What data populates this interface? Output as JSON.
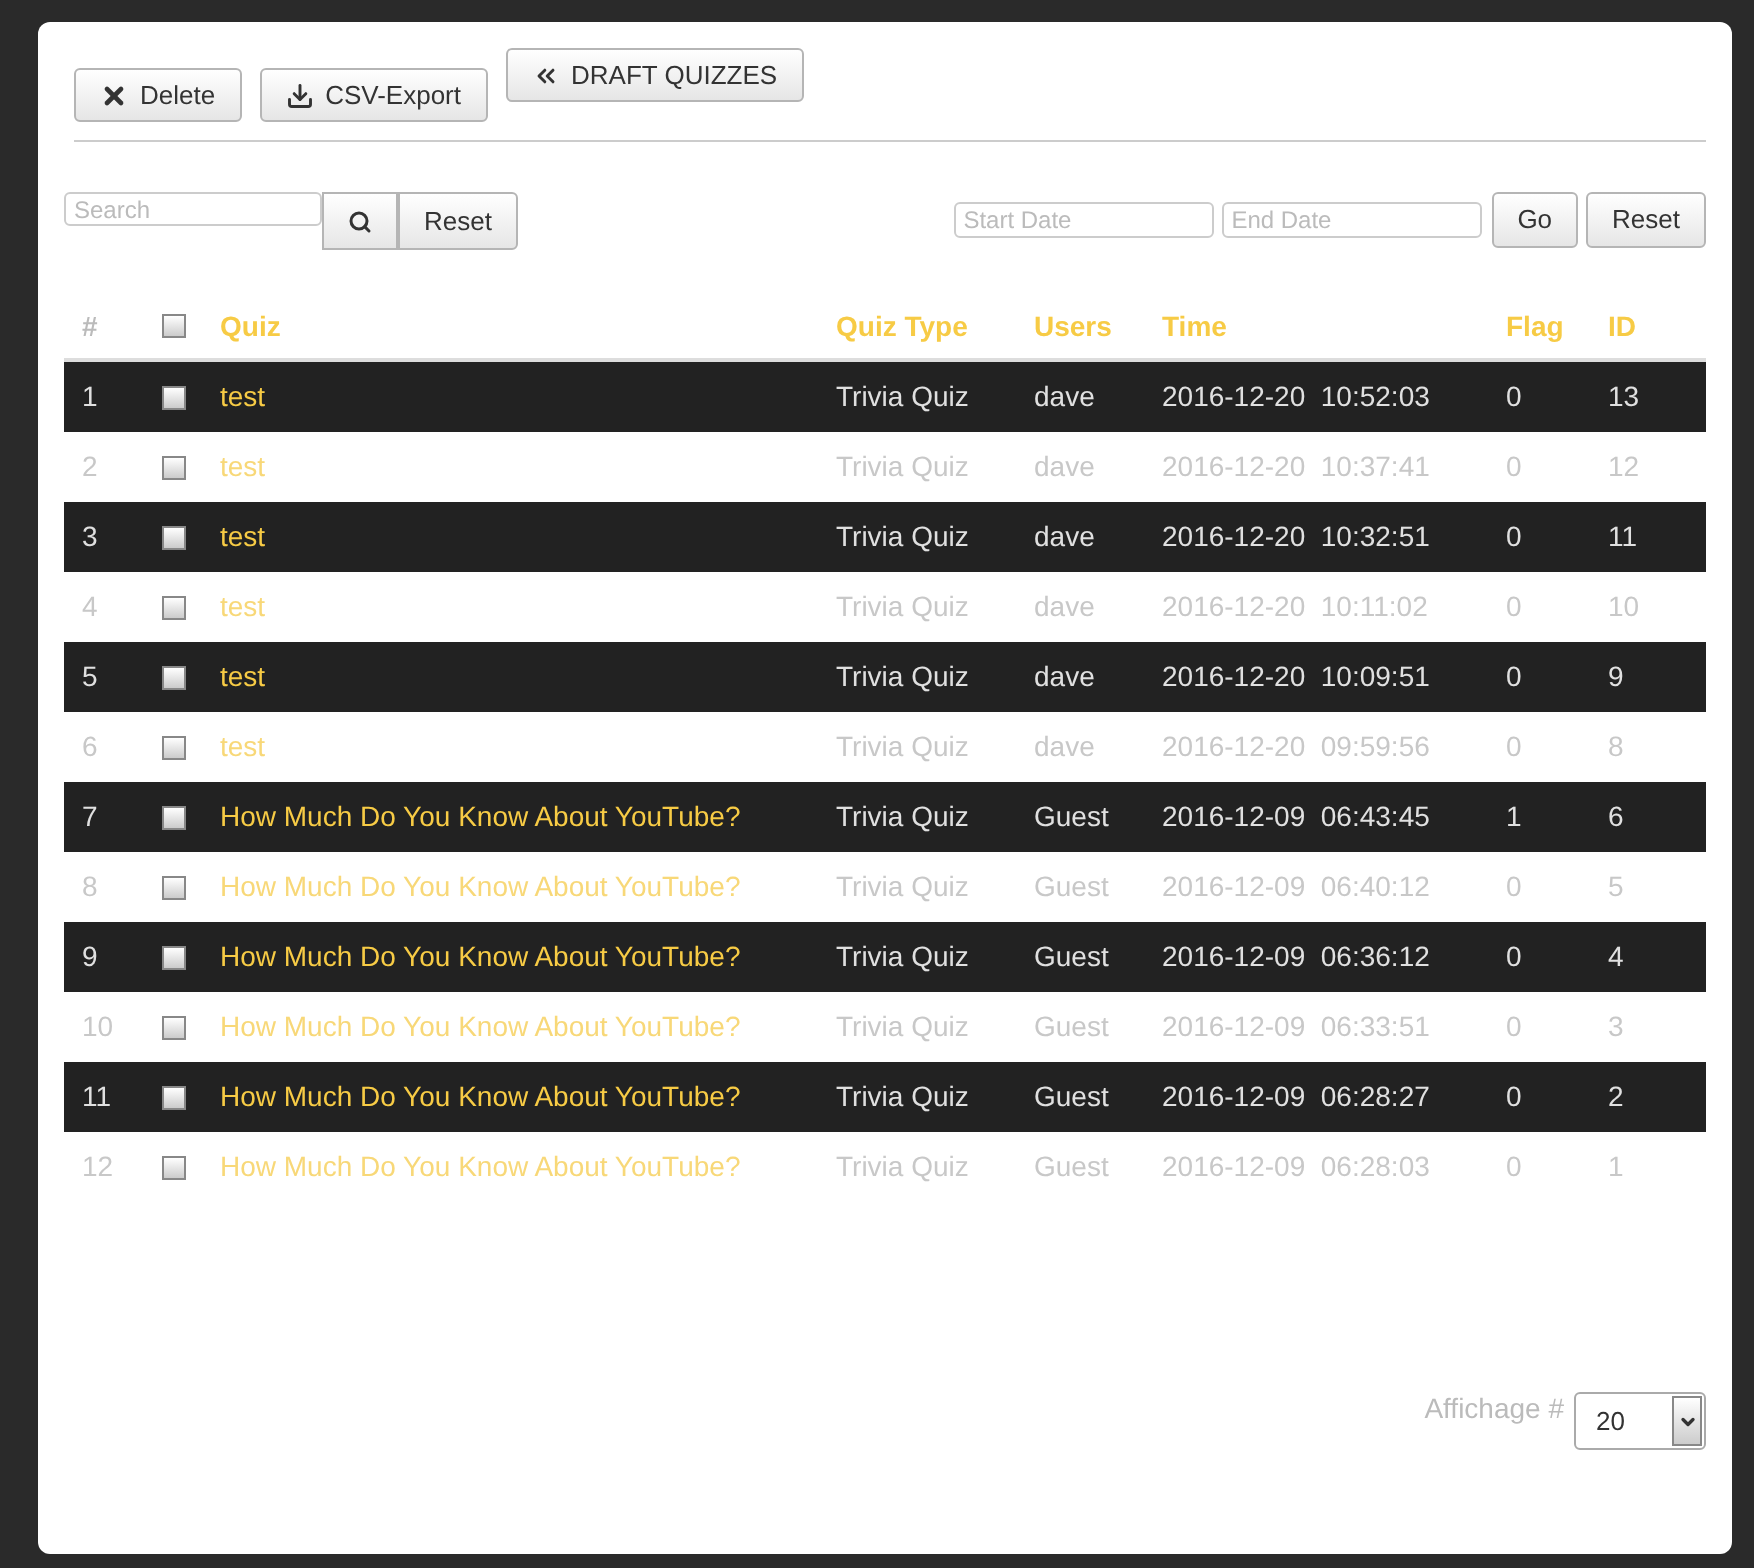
{
  "toolbar": {
    "buttons": [
      "Delete",
      "CSV-Export",
      "DRAFT QUIZZES"
    ]
  },
  "search": {
    "placeholder": "Search",
    "reset": "Reset"
  },
  "date_filter": {
    "start_placeholder": "Start Date",
    "end_placeholder": "End Date",
    "go": "Go",
    "reset": "Reset"
  },
  "table": {
    "columns": [
      "#",
      "Quiz",
      "Quiz Type",
      "Users",
      "Time",
      "Flag",
      "ID"
    ],
    "header_checked": false,
    "rows": [
      {
        "num": "1",
        "checked": false,
        "quiz": "test",
        "type": "Trivia Quiz",
        "user": "dave",
        "time": "2016-12-20  10:52:03",
        "flag": "0",
        "id": "13"
      },
      {
        "num": "2",
        "checked": false,
        "quiz": "test",
        "type": "Trivia Quiz",
        "user": "dave",
        "time": "2016-12-20  10:37:41",
        "flag": "0",
        "id": "12"
      },
      {
        "num": "3",
        "checked": false,
        "quiz": "test",
        "type": "Trivia Quiz",
        "user": "dave",
        "time": "2016-12-20  10:32:51",
        "flag": "0",
        "id": "11"
      },
      {
        "num": "4",
        "checked": false,
        "quiz": "test",
        "type": "Trivia Quiz",
        "user": "dave",
        "time": "2016-12-20  10:11:02",
        "flag": "0",
        "id": "10"
      },
      {
        "num": "5",
        "checked": false,
        "quiz": "test",
        "type": "Trivia Quiz",
        "user": "dave",
        "time": "2016-12-20  10:09:51",
        "flag": "0",
        "id": "9"
      },
      {
        "num": "6",
        "checked": false,
        "quiz": "test",
        "type": "Trivia Quiz",
        "user": "dave",
        "time": "2016-12-20  09:59:56",
        "flag": "0",
        "id": "8"
      },
      {
        "num": "7",
        "checked": false,
        "quiz": "How Much Do You Know About YouTube?",
        "type": "Trivia Quiz",
        "user": "Guest",
        "time": "2016-12-09  06:43:45",
        "flag": "1",
        "id": "6"
      },
      {
        "num": "8",
        "checked": false,
        "quiz": "How Much Do You Know About YouTube?",
        "type": "Trivia Quiz",
        "user": "Guest",
        "time": "2016-12-09  06:40:12",
        "flag": "0",
        "id": "5"
      },
      {
        "num": "9",
        "checked": false,
        "quiz": "How Much Do You Know About YouTube?",
        "type": "Trivia Quiz",
        "user": "Guest",
        "time": "2016-12-09  06:36:12",
        "flag": "0",
        "id": "4"
      },
      {
        "num": "10",
        "checked": false,
        "quiz": "How Much Do You Know About YouTube?",
        "type": "Trivia Quiz",
        "user": "Guest",
        "time": "2016-12-09  06:33:51",
        "flag": "0",
        "id": "3"
      },
      {
        "num": "11",
        "checked": false,
        "quiz": "How Much Do You Know About YouTube?",
        "type": "Trivia Quiz",
        "user": "Guest",
        "time": "2016-12-09  06:28:27",
        "flag": "0",
        "id": "2"
      },
      {
        "num": "12",
        "checked": false,
        "quiz": "How Much Do You Know About YouTube?",
        "type": "Trivia Quiz",
        "user": "Guest",
        "time": "2016-12-09  06:28:03",
        "flag": "0",
        "id": "1"
      }
    ]
  },
  "pagination": {
    "label": "Affichage #",
    "value": "20"
  }
}
